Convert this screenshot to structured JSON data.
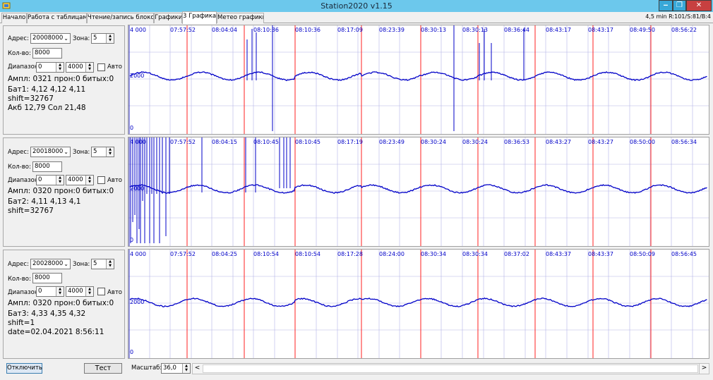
{
  "window": {
    "title": "Station2020 v1.15",
    "minimize_glyph": "‒",
    "maximize_glyph": "❐",
    "close_glyph": "✕"
  },
  "tabs": [
    "Начало",
    "Работа с таблицами",
    "Чтение/запись блоков",
    "Графики",
    "3 Графика",
    "Метео графики"
  ],
  "active_tab": "3 Графика",
  "status_right": "4,5 min R:101/S:81/B:4",
  "panels": [
    {
      "address_label": "Адрес:",
      "address": "20008000",
      "zone_label": "Зона:",
      "zone": "5",
      "count_label": "Кол-во:",
      "count": "8000",
      "range_label": "Диапазон",
      "range_from": "0",
      "range_to": "4000",
      "auto_label": "Авто",
      "info": [
        "Ампл: 0321 прон:0 битых:0",
        "Бат1: 4,12 4,12 4,11",
        " shift=32767",
        "Акб 12,79 Сол 21,48"
      ]
    },
    {
      "address_label": "Адрес:",
      "address": "20018000",
      "zone_label": "Зона:",
      "zone": "5",
      "count_label": "Кол-во:",
      "count": "8000",
      "range_label": "Диапазон",
      "range_from": "0",
      "range_to": "4000",
      "auto_label": "Авто",
      "info": [
        "Ампл: 0320 прон:0 битых:0",
        "Бат2: 4,11 4,13 4,1",
        " shift=32767"
      ]
    },
    {
      "address_label": "Адрес:",
      "address": "20028000",
      "zone_label": "Зона:",
      "zone": "5",
      "count_label": "Кол-во:",
      "count": "8000",
      "range_label": "Диапазон",
      "range_from": "0",
      "range_to": "4000",
      "auto_label": "Авто",
      "info": [
        "Ампл: 0320 прон:0 битых:0",
        "Бат3: 4,33 4,35 4,32",
        " shift=1",
        " date=02.04.2021 8:56:11"
      ]
    }
  ],
  "charts": [
    {
      "y_top": "4 000",
      "y_mid": "2000",
      "y_bottom": "0",
      "times": [
        "07:57:52",
        "08:04:04",
        "08:10:36",
        "08:10:36",
        "08:17:09",
        "08:23:39",
        "08:30:13",
        "08:30:13",
        "08:36:44",
        "08:43:17",
        "08:43:17",
        "08:49:50",
        "08:56:22"
      ],
      "spikes": "low"
    },
    {
      "y_top": "4 000",
      "y_mid": "2000",
      "y_bottom": "0",
      "times": [
        "07:57:52",
        "08:04:15",
        "08:10:45",
        "08:10:45",
        "08:17:19",
        "08:23:49",
        "08:30:24",
        "08:30:24",
        "08:36:53",
        "08:43:27",
        "08:43:27",
        "08:50:00",
        "08:56:34"
      ],
      "spikes": "heavy"
    },
    {
      "y_top": "4 000",
      "y_mid": "2000",
      "y_bottom": "0",
      "times": [
        "07:57:52",
        "08:04:25",
        "08:10:54",
        "08:10:54",
        "08:17:28",
        "08:24:00",
        "08:30:34",
        "08:30:34",
        "08:37:02",
        "08:43:37",
        "08:43:37",
        "08:50:09",
        "08:56:45"
      ],
      "spikes": "none"
    }
  ],
  "colors": {
    "plot_line": "#0000c8",
    "grid": "#b4b4e6",
    "red_marker": "#ff2020",
    "axis_text": "#0000c8"
  },
  "bottom": {
    "disconnect": "Отключить",
    "test": "Тест",
    "scale_label": "Масштаб:",
    "scale_value": "36,0",
    "scroll_left": "<",
    "scroll_right": ">"
  }
}
